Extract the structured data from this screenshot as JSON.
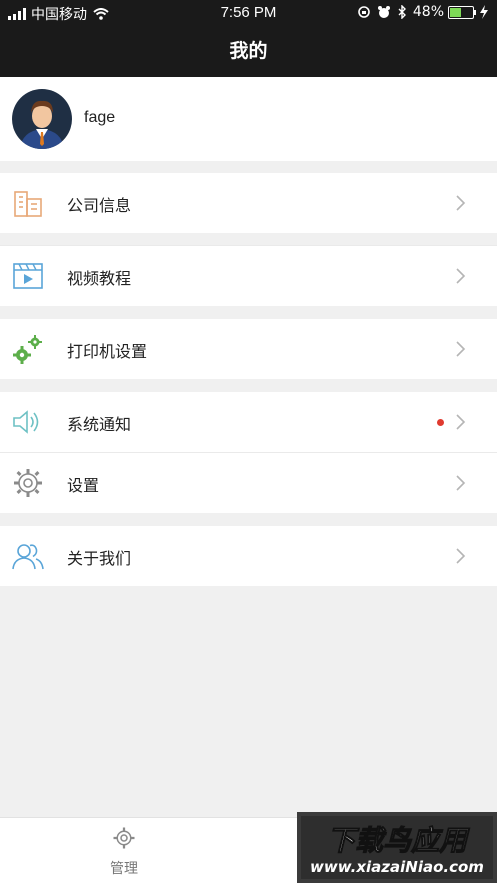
{
  "status_bar": {
    "carrier": "中国移动",
    "time": "7:56 PM",
    "battery": "48%",
    "battery_level": 0.48
  },
  "header": {
    "title": "我的"
  },
  "profile": {
    "name": "fage"
  },
  "menu": [
    {
      "label": "公司信息",
      "icon": "building-icon"
    },
    {
      "label": "视频教程",
      "icon": "video-icon"
    },
    {
      "label": "打印机设置",
      "icon": "gears-icon"
    },
    {
      "label": "系统通知",
      "icon": "speaker-icon",
      "badge": "red-dot"
    },
    {
      "label": "设置",
      "icon": "gear-icon"
    },
    {
      "label": "关于我们",
      "icon": "people-icon"
    }
  ],
  "tabbar": {
    "tabs": [
      {
        "label": "管理",
        "icon": "gear-icon"
      }
    ]
  },
  "watermark": {
    "text": "下载写应用",
    "url": "www.xiazaiNiao.com"
  },
  "colors": {
    "accent_red": "#e03a2f",
    "navbar_bg": "#1a1a1a",
    "page_bg": "#f0f0f0"
  }
}
